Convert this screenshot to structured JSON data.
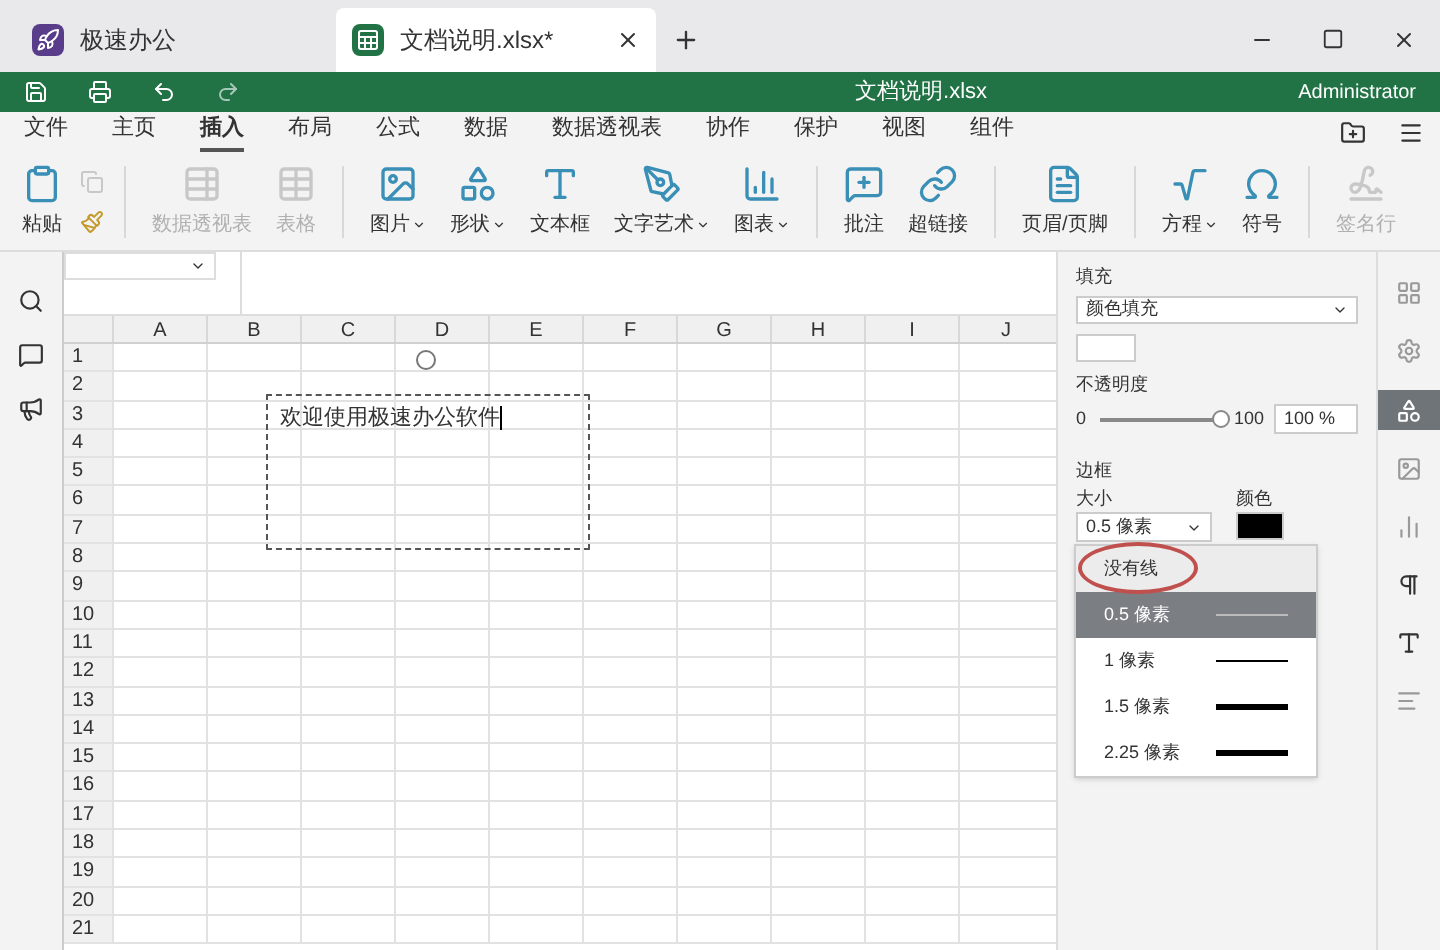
{
  "tabs": [
    {
      "label": "极速办公",
      "selected": false,
      "closable": false
    },
    {
      "label": "文档说明.xlsx*",
      "selected": true,
      "closable": true
    }
  ],
  "title_bar": {
    "title": "文档说明.xlsx",
    "user": "Administrator"
  },
  "menu": [
    {
      "label": "文件",
      "selected": false
    },
    {
      "label": "主页",
      "selected": false
    },
    {
      "label": "插入",
      "selected": true
    },
    {
      "label": "布局",
      "selected": false
    },
    {
      "label": "公式",
      "selected": false
    },
    {
      "label": "数据",
      "selected": false
    },
    {
      "label": "数据透视表",
      "selected": false
    },
    {
      "label": "协作",
      "selected": false
    },
    {
      "label": "保护",
      "selected": false
    },
    {
      "label": "视图",
      "selected": false
    },
    {
      "label": "组件",
      "selected": false
    }
  ],
  "ribbon": [
    {
      "kind": "paste",
      "label": "粘贴",
      "disabled": false,
      "dropdown": false
    },
    {
      "kind": "pivot",
      "label": "数据透视表",
      "disabled": true,
      "dropdown": false
    },
    {
      "kind": "table",
      "label": "表格",
      "disabled": true,
      "dropdown": false
    },
    {
      "kind": "image",
      "label": "图片",
      "disabled": false,
      "dropdown": true
    },
    {
      "kind": "shape",
      "label": "形状",
      "disabled": false,
      "dropdown": true
    },
    {
      "kind": "textbox",
      "label": "文本框",
      "disabled": false,
      "dropdown": false
    },
    {
      "kind": "art",
      "label": "文字艺术",
      "disabled": false,
      "dropdown": true
    },
    {
      "kind": "chart",
      "label": "图表",
      "disabled": false,
      "dropdown": true
    },
    {
      "kind": "comment",
      "label": "批注",
      "disabled": false,
      "dropdown": false
    },
    {
      "kind": "link",
      "label": "超链接",
      "disabled": false,
      "dropdown": false
    },
    {
      "kind": "header",
      "label": "页眉/页脚",
      "disabled": false,
      "dropdown": false
    },
    {
      "kind": "equation",
      "label": "方程",
      "disabled": false,
      "dropdown": true
    },
    {
      "kind": "symbol",
      "label": "符号",
      "disabled": false,
      "dropdown": false
    },
    {
      "kind": "sign",
      "label": "签名行",
      "disabled": true,
      "dropdown": false
    }
  ],
  "sheet": {
    "columns": [
      "A",
      "B",
      "C",
      "D",
      "E",
      "F",
      "G",
      "H",
      "I",
      "J"
    ],
    "rows": [
      "1",
      "2",
      "3",
      "4",
      "5",
      "6",
      "7",
      "8",
      "9",
      "10",
      "11",
      "12",
      "13",
      "14",
      "15",
      "16",
      "17",
      "18",
      "19",
      "20",
      "21"
    ],
    "textbox": "欢迎使用极速办公软件"
  },
  "panel": {
    "fill_label": "填充",
    "fill_type": "颜色填充",
    "opacity_label": "不透明度",
    "slider_min": "0",
    "slider_max": "100",
    "level": 1,
    "opacity_value": "100 %",
    "border_label": "边框",
    "size_label": "大小",
    "size_value": "0.5 像素",
    "color_label": "颜色",
    "options": [
      {
        "label": "没有线",
        "kind": "none",
        "selected": false
      },
      {
        "label": "0.5 像素",
        "kind": "line",
        "selected": true
      },
      {
        "label": "1 像素",
        "kind": "line",
        "selected": false
      },
      {
        "label": "1.5 像素",
        "kind": "line",
        "selected": false
      },
      {
        "label": "2.25 像素",
        "kind": "line",
        "selected": false
      }
    ]
  }
}
